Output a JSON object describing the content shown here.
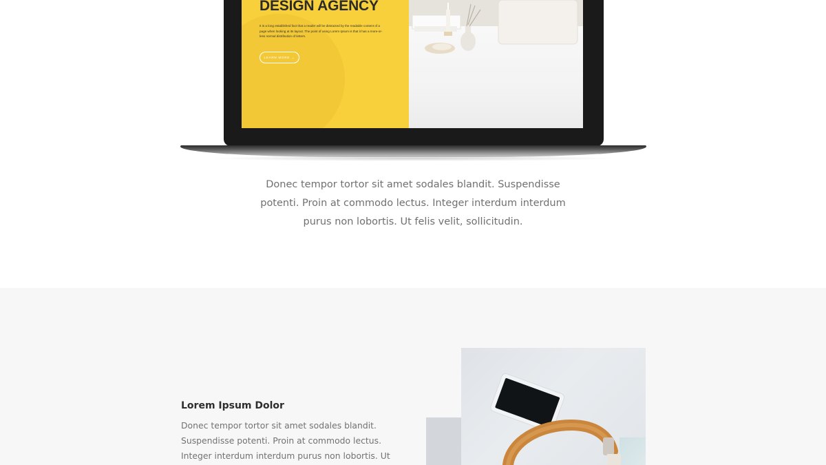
{
  "laptop": {
    "headline": "DESIGN AGENCY",
    "body": "It is a long established fact that a reader will be distracted by the readable content of a page when looking at its layout. The point of using Lorem Ipsum is that it has a more-or-less normal distribution of letters.",
    "button_label": "LEARN MORE →"
  },
  "intro": {
    "text": "Donec tempor tortor sit amet sodales blandit. Suspendisse potenti. Proin at commodo lectus. Integer interdum interdum purus non lobortis. Ut felis velit, sollicitudin."
  },
  "feature": {
    "title": "Lorem Ipsum Dolor",
    "text": "Donec tempor tortor sit amet sodales blandit. Suspendisse potenti. Proin at commodo lectus. Integer interdum interdum purus non lobortis. Ut felis velit,"
  },
  "colors": {
    "accent_yellow": "#f8d03b",
    "text_gray": "#707070",
    "section_gray": "#f7f7f7"
  }
}
